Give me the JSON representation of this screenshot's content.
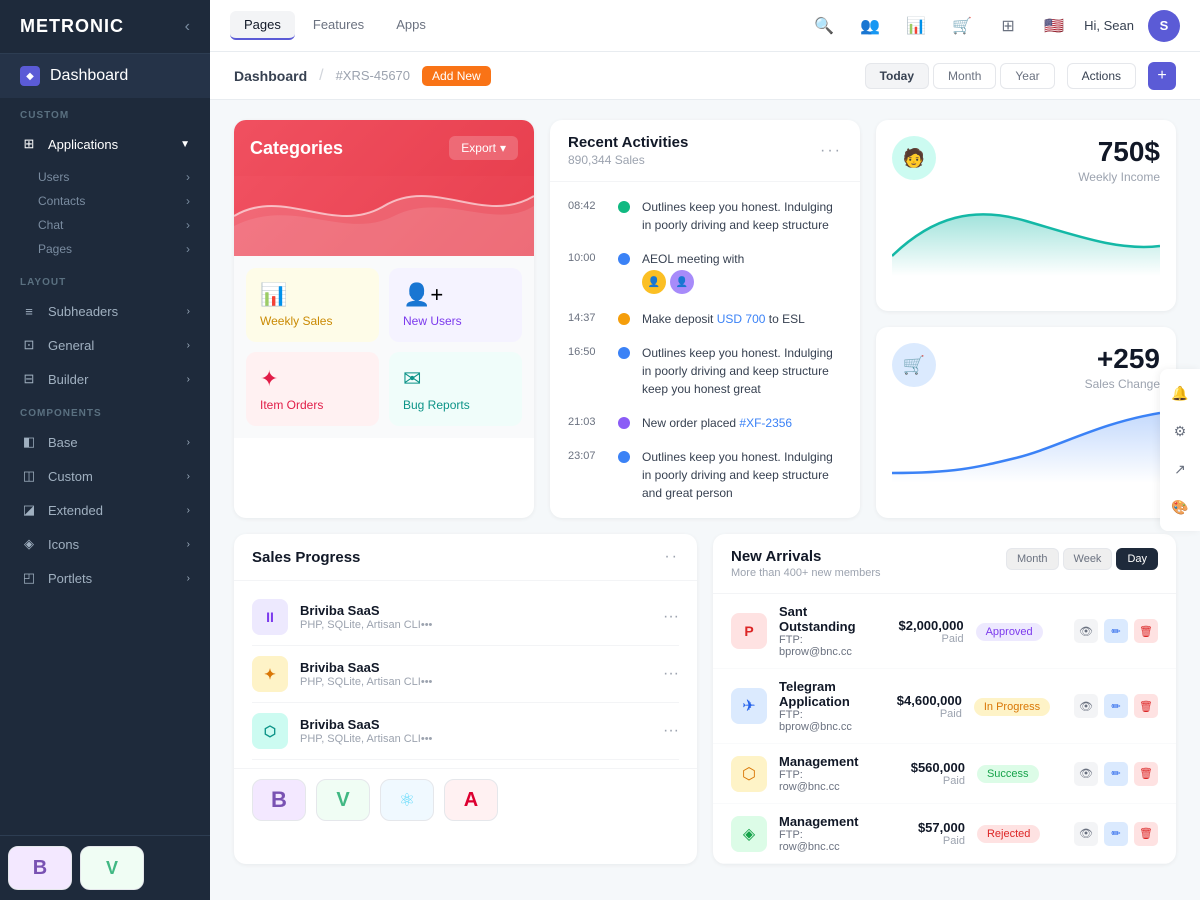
{
  "brand": {
    "name": "METRONIC",
    "toggle": "‹"
  },
  "sidebar": {
    "dashboard_label": "Dashboard",
    "sections": [
      {
        "label": "CUSTOM",
        "items": [
          {
            "id": "applications",
            "label": "Applications",
            "icon": "⊞",
            "has_arrow": true,
            "expanded": true
          },
          {
            "id": "users",
            "label": "Users",
            "sub": true,
            "has_arrow": true
          },
          {
            "id": "contacts",
            "label": "Contacts",
            "sub": true,
            "has_arrow": true
          },
          {
            "id": "chat",
            "label": "Chat",
            "sub": true,
            "has_arrow": true
          },
          {
            "id": "pages",
            "label": "Pages",
            "sub": true,
            "has_arrow": true
          }
        ]
      },
      {
        "label": "LAYOUT",
        "items": [
          {
            "id": "subheaders",
            "label": "Subheaders",
            "icon": "≡",
            "has_arrow": true
          },
          {
            "id": "general",
            "label": "General",
            "icon": "⊡",
            "has_arrow": true
          },
          {
            "id": "builder",
            "label": "Builder",
            "icon": "⊟",
            "has_arrow": true
          }
        ]
      },
      {
        "label": "COMPONENTS",
        "items": [
          {
            "id": "base",
            "label": "Base",
            "icon": "◧",
            "has_arrow": true
          },
          {
            "id": "custom",
            "label": "Custom",
            "icon": "◫",
            "has_arrow": true
          },
          {
            "id": "extended",
            "label": "Extended",
            "icon": "◪",
            "has_arrow": true
          },
          {
            "id": "icons",
            "label": "Icons",
            "icon": "◈",
            "has_arrow": true
          },
          {
            "id": "portlets",
            "label": "Portlets",
            "icon": "◰",
            "has_arrow": true
          }
        ]
      }
    ]
  },
  "topnav": {
    "links": [
      {
        "id": "pages",
        "label": "Pages",
        "active": true
      },
      {
        "id": "features",
        "label": "Features"
      },
      {
        "id": "apps",
        "label": "Apps"
      }
    ],
    "user": {
      "greeting": "Hi, Sean",
      "avatar_letter": "S"
    }
  },
  "breadcrumb": {
    "title": "Dashboard",
    "ref": "#XRS-45670",
    "add_new": "Add New",
    "time_buttons": [
      "Today",
      "Month",
      "Year"
    ],
    "active_time": "Today",
    "actions_label": "Actions",
    "plus": "+"
  },
  "categories": {
    "title": "Categories",
    "export_label": "Export",
    "items": [
      {
        "id": "weekly-sales",
        "label": "Weekly Sales",
        "bg": "yellow",
        "icon": "📊"
      },
      {
        "id": "new-users",
        "label": "New Users",
        "bg": "purple",
        "icon": "👤"
      },
      {
        "id": "item-orders",
        "label": "Item Orders",
        "bg": "pink",
        "icon": "❖"
      },
      {
        "id": "bug-reports",
        "label": "Bug Reports",
        "bg": "teal",
        "icon": "✉"
      }
    ]
  },
  "recent_activities": {
    "title": "Recent Activities",
    "subtitle": "890,344 Sales",
    "items": [
      {
        "time": "08:42",
        "dot": "green",
        "text": "Outlines keep you honest. Indulging in poorly driving and keep structure"
      },
      {
        "time": "10:00",
        "dot": "blue",
        "text": "AEOL meeting with",
        "has_avatars": true
      },
      {
        "time": "14:37",
        "dot": "orange",
        "text": "Make deposit USD 700 to ESL",
        "highlight": "USD 700"
      },
      {
        "time": "16:50",
        "dot": "blue",
        "text": "Outlines keep you honest. Indulging in poorly driving and keep structure keep you honest great"
      },
      {
        "time": "21:03",
        "dot": "purple",
        "text": "New order placed #XF-2356",
        "highlight": "#XF-2356"
      },
      {
        "time": "23:07",
        "dot": "blue",
        "text": "Outlines keep you honest. Indulging in poorly driving and keep structure and great person"
      }
    ]
  },
  "stats": {
    "weekly_income": {
      "value": "750$",
      "label": "Weekly Income"
    },
    "sales_change": {
      "value": "+259",
      "label": "Sales Change"
    }
  },
  "sales_progress": {
    "title": "Sales Progress",
    "items": [
      {
        "logo": "II",
        "logo_bg": "purple",
        "name": "Briviba SaaS",
        "desc": "PHP, SQLite, Artisan CLI•••"
      },
      {
        "logo": "✦",
        "logo_bg": "yellow",
        "name": "Briviba SaaS",
        "desc": "PHP, SQLite, Artisan CLI•••"
      },
      {
        "logo": "⬡",
        "logo_bg": "teal",
        "name": "Briviba SaaS",
        "desc": "PHP, SQLite, Artisan CLI•••"
      }
    ]
  },
  "new_arrivals": {
    "title": "New Arrivals",
    "subtitle": "More than 400+ new members",
    "tabs": [
      "Month",
      "Week",
      "Day"
    ],
    "active_tab": "Day",
    "rows": [
      {
        "icon": "🅿",
        "icon_bg": "#fee2e2",
        "name": "Sant Outstanding",
        "ftp_label": "FTP:",
        "ftp": "bprow@bnc.cc",
        "price": "$2,000,000",
        "paid": "Paid",
        "status": "Approved",
        "status_type": "approved"
      },
      {
        "icon": "✈",
        "icon_bg": "#dbeafe",
        "name": "Telegram Application",
        "ftp_label": "FTP:",
        "ftp": "bprow@bnc.cc",
        "price": "$4,600,000",
        "paid": "Paid",
        "status": "In Progress",
        "status_type": "progress"
      },
      {
        "icon": "🔶",
        "icon_bg": "#fef3c7",
        "name": "Management",
        "ftp_label": "FTP:",
        "ftp": "row@bnc.cc",
        "price": "$560,000",
        "paid": "Paid",
        "status": "Success",
        "status_type": "success"
      },
      {
        "icon": "🔷",
        "icon_bg": "#dcfce7",
        "name": "Management",
        "ftp_label": "FTP:",
        "ftp": "row@bnc.cc",
        "price": "$57,000",
        "paid": "Paid",
        "status": "Rejected",
        "status_type": "rejected"
      }
    ]
  },
  "frameworks": [
    {
      "icon": "B",
      "color": "#7952b3",
      "bg": "#f3e8ff",
      "label": "Bootstrap"
    },
    {
      "icon": "V",
      "color": "#41b883",
      "bg": "#f0fdf4",
      "label": "Vue"
    },
    {
      "icon": "⚛",
      "color": "#61dafb",
      "bg": "#f0f9ff",
      "label": "React"
    },
    {
      "icon": "A",
      "color": "#dd0031",
      "bg": "#fff1f2",
      "label": "Angular"
    }
  ],
  "right_icons": [
    "🔔",
    "⚙",
    "↗",
    "🎨"
  ]
}
